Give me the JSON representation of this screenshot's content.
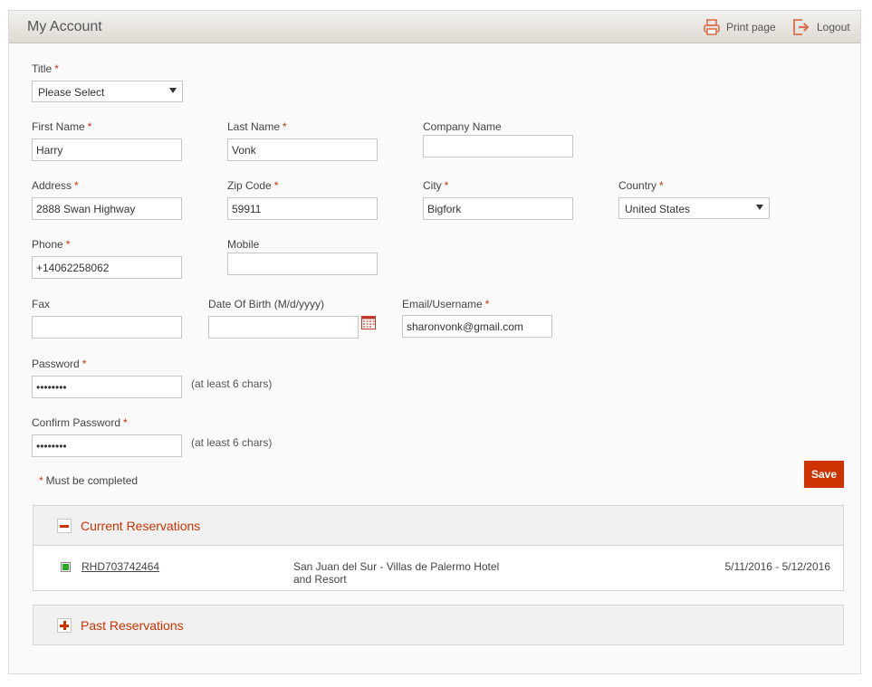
{
  "header": {
    "title": "My Account",
    "print_label": "Print page",
    "logout_label": "Logout"
  },
  "form": {
    "title": {
      "label": "Title",
      "value": "Please Select"
    },
    "first_name": {
      "label": "First Name",
      "value": "Harry"
    },
    "last_name": {
      "label": "Last Name",
      "value": "Vonk"
    },
    "company_name": {
      "label": "Company Name",
      "value": ""
    },
    "address": {
      "label": "Address",
      "value": "2888 Swan Highway"
    },
    "zip_code": {
      "label": "Zip Code",
      "value": "59911"
    },
    "city": {
      "label": "City",
      "value": "Bigfork"
    },
    "country": {
      "label": "Country",
      "value": "United States"
    },
    "phone": {
      "label": "Phone",
      "value": "+14062258062"
    },
    "mobile": {
      "label": "Mobile",
      "value": ""
    },
    "fax": {
      "label": "Fax",
      "value": ""
    },
    "dob": {
      "label": "Date Of Birth (M/d/yyyy)",
      "value": ""
    },
    "email": {
      "label": "Email/Username",
      "value": "sharonvonk@gmail.com"
    },
    "password": {
      "label": "Password",
      "value": "••••••••",
      "hint": "(at least 6 chars)"
    },
    "confirm_password": {
      "label": "Confirm Password",
      "value": "••••••••",
      "hint": "(at least 6 chars)"
    },
    "required_marker": "*",
    "required_note": "Must be completed",
    "save_label": "Save"
  },
  "reservations": {
    "current": {
      "title": "Current Reservations",
      "items": [
        {
          "code": "RHD703742464",
          "hotel": "San Juan del Sur - Villas de Palermo Hotel and Resort",
          "dates": "5/11/2016 - 5/12/2016"
        }
      ]
    },
    "past": {
      "title": "Past Reservations"
    }
  },
  "colors": {
    "accent": "#cc3300",
    "status_active": "#22aa22"
  }
}
